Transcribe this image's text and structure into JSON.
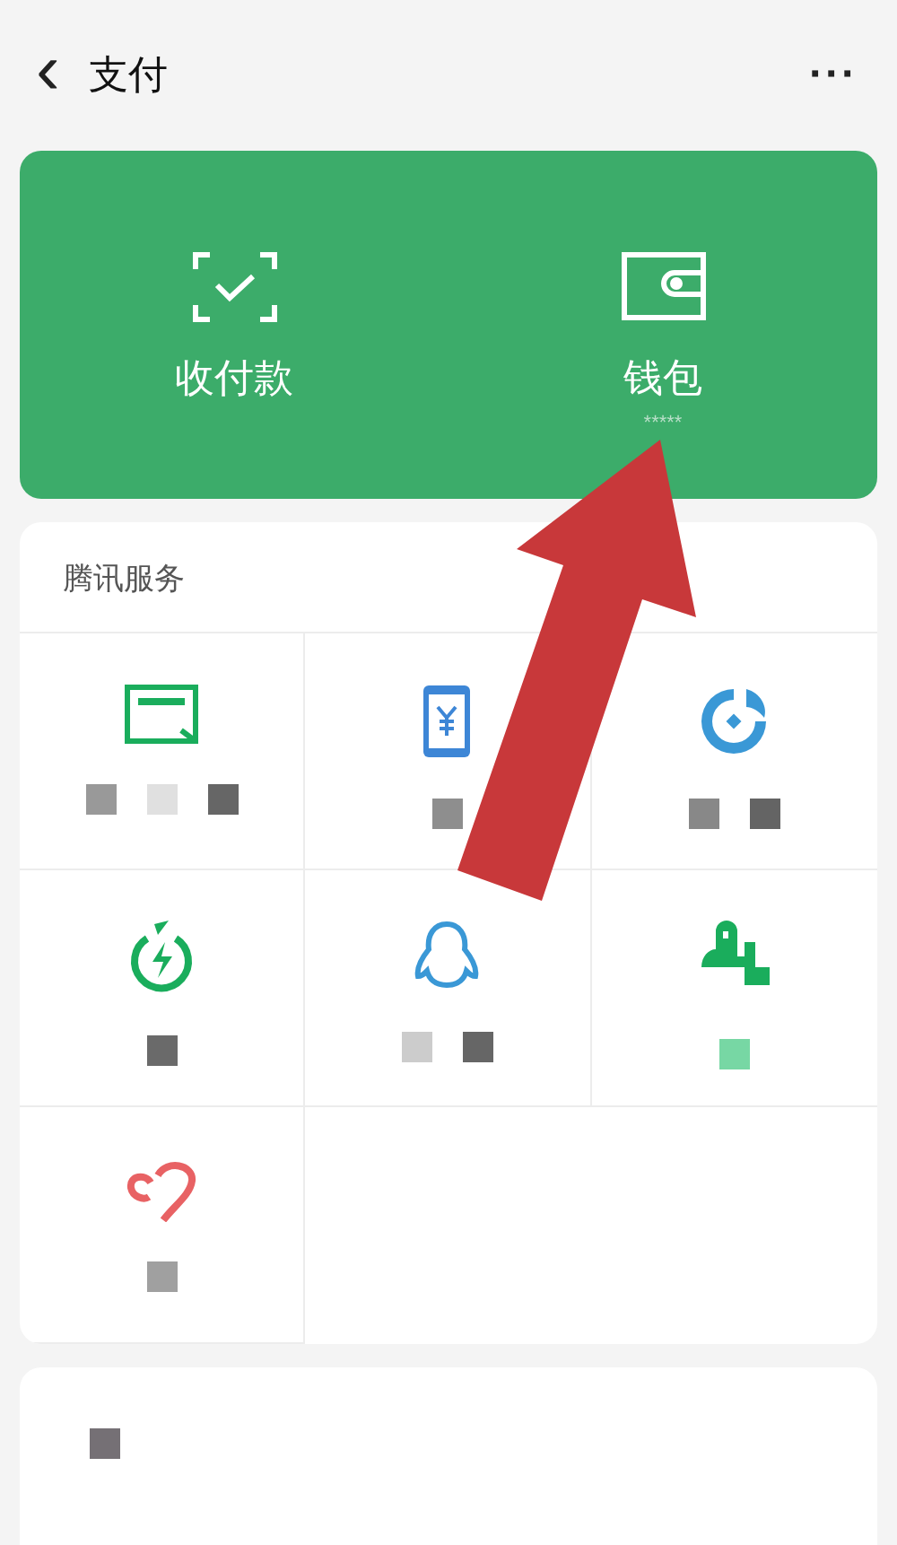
{
  "nav_bar": {
    "back_glyph": "‹",
    "title": "支付",
    "more_glyph": "···"
  },
  "top_card": {
    "items": [
      {
        "kind": "scan",
        "label": "收付款"
      },
      {
        "kind": "wallet",
        "label": "钱包",
        "sub": "*****"
      }
    ]
  },
  "tencent_services": {
    "title": "腾讯服务",
    "tiles": [
      {
        "kind": "card",
        "masks": [
          {
            "color": "#999999"
          },
          {
            "color": "#e0e0e0"
          },
          {
            "color": "#666666"
          }
        ]
      },
      {
        "kind": "phone",
        "masks": [
          {
            "color": "#8e8e8e"
          }
        ]
      },
      {
        "kind": "fish",
        "masks": [
          {
            "color": "#888888"
          },
          {
            "color": "#646464"
          }
        ]
      },
      {
        "kind": "bolt",
        "masks": [
          {
            "color": "#6a6a6a"
          }
        ]
      },
      {
        "kind": "penguin",
        "masks": [
          {
            "color": "#cccccc"
          },
          {
            "color": "#666666"
          }
        ]
      },
      {
        "kind": "city",
        "masks": [
          {
            "color": "#77d7a4"
          }
        ]
      },
      {
        "kind": "heart",
        "masks": [
          {
            "color": "#a0a0a0"
          }
        ]
      }
    ]
  },
  "second_panel": {
    "masks": [
      {
        "color": "#757075"
      }
    ]
  },
  "annotation": {
    "kind": "arrow"
  }
}
